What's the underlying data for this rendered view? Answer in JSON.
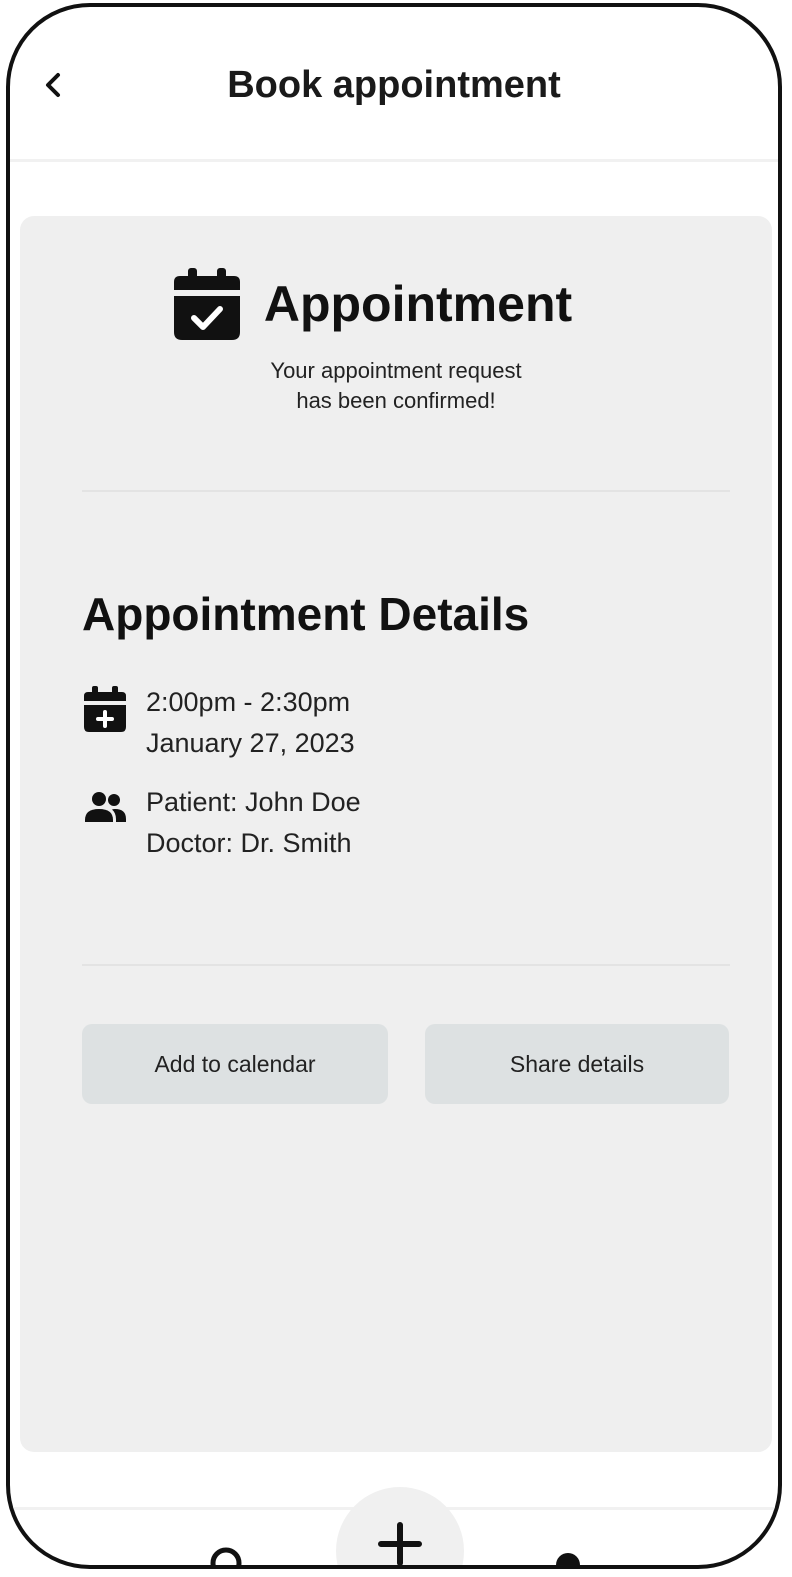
{
  "header": {
    "title": "Book appointment"
  },
  "confirmation": {
    "title": "Appointment",
    "message_line1": "Your appointment request",
    "message_line2": "has been confirmed!",
    "icon": "calendar-check-icon"
  },
  "details": {
    "title": "Appointment Details",
    "time_range": "2:00pm - 2:30pm",
    "date": "January 27, 2023",
    "patient": "Patient: John Doe",
    "doctor": "Doctor: Dr. Smith",
    "time_icon": "calendar-plus-icon",
    "people_icon": "people-icon"
  },
  "actions": {
    "add_to_calendar": "Add to calendar",
    "share_details": "Share details"
  },
  "bottom_nav": {
    "left_icon": "search-icon",
    "center_icon": "plus-icon",
    "right_icon": "profile-icon"
  },
  "colors": {
    "card_background": "#efefef",
    "button_background": "#dde1e2",
    "text_primary": "#111111"
  }
}
